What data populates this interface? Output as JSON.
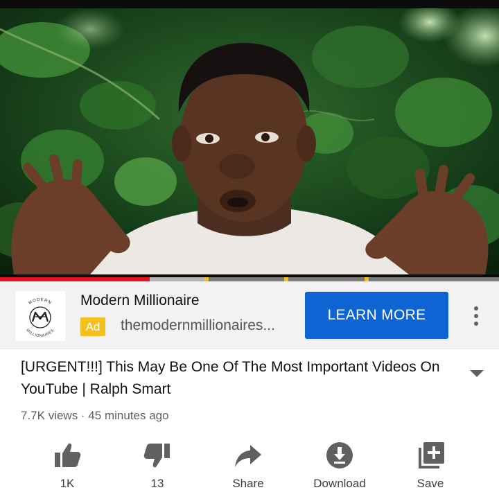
{
  "player": {
    "progress_fraction": 0.3,
    "buffered_fraction": 0.41,
    "ad_markers": [
      0.41,
      0.57,
      0.73
    ],
    "colors": {
      "played": "#e8141f",
      "ad_marker": "#f3c01e"
    }
  },
  "ad": {
    "logo_name": "modern-millionaires-logo",
    "logo_text_top": "MODERN",
    "logo_text_bottom": "MILLIONAIRES",
    "title": "Modern Millionaire",
    "badge": "Ad",
    "url": "themodernmillionaires...",
    "cta_label": "LEARN MORE",
    "cta_color": "#0e64d2"
  },
  "video": {
    "title": "[URGENT!!!] This May Be One Of The Most Important Videos On YouTube | Ralph Smart",
    "meta": "7.7K views · 45 minutes ago"
  },
  "actions": [
    {
      "icon": "thumbs-up-icon",
      "label": "1K"
    },
    {
      "icon": "thumbs-down-icon",
      "label": "13"
    },
    {
      "icon": "share-icon",
      "label": "Share"
    },
    {
      "icon": "download-icon",
      "label": "Download"
    },
    {
      "icon": "save-playlist-icon",
      "label": "Save"
    }
  ]
}
